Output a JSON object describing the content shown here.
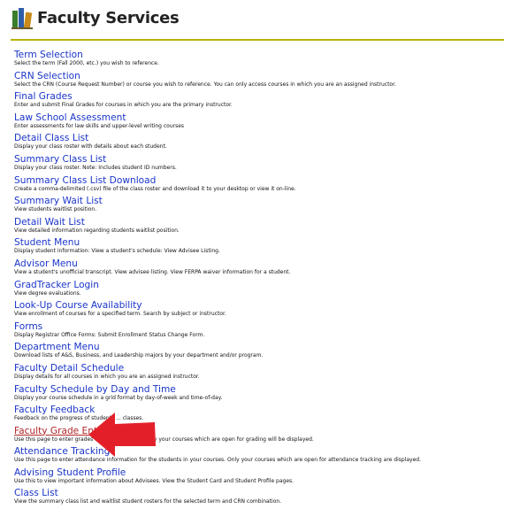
{
  "header": {
    "title": "Faculty Services",
    "accent_color": "#b9b400",
    "logo_icon": "books-icon"
  },
  "menu": [
    {
      "label": "Term Selection",
      "desc": "Select the term (Fall 2000, etc.) you wish to reference."
    },
    {
      "label": "CRN Selection",
      "desc": "Select the CRN (Course Request Number) or course you wish to reference. You can only access courses in which you are an assigned instructor."
    },
    {
      "label": "Final Grades",
      "desc": "Enter and submit Final Grades for courses in which you are the primary instructor."
    },
    {
      "label": "Law School Assessment",
      "desc": "Enter assessments for law skills and upper-level writing courses"
    },
    {
      "label": "Detail Class List",
      "desc": "Display your class roster with details about each student."
    },
    {
      "label": "Summary Class List",
      "desc": "Display your class roster. Note: Includes student ID numbers."
    },
    {
      "label": "Summary Class List Download",
      "desc": "Create a comma-delimited (.csv) file of the class roster and download it to your desktop or view it on-line."
    },
    {
      "label": "Summary Wait List",
      "desc": "View students waitlist position."
    },
    {
      "label": "Detail Wait List",
      "desc": "View detailed information regarding students waitlist position."
    },
    {
      "label": "Student Menu",
      "desc": "Display student information: View a student's schedule: View Advisee Listing."
    },
    {
      "label": "Advisor Menu",
      "desc": "View a student's unofficial transcript. View advisee listing. View FERPA waiver information for a student."
    },
    {
      "label": "GradTracker Login",
      "desc": "View degree evaluations."
    },
    {
      "label": "Look-Up Course Availability",
      "desc": "View enrollment of courses for a specified term. Search by subject or instructor."
    },
    {
      "label": "Forms",
      "desc": "Display Registrar Office Forms: Submit Enrollment Status Change Form."
    },
    {
      "label": "Department Menu",
      "desc": "Download lists of A&S, Business, and Leadership majors by your department and/or program."
    },
    {
      "label": "Faculty Detail Schedule",
      "desc": "Display details for all courses in which you are an assigned instructor."
    },
    {
      "label": "Faculty Schedule by Day and Time",
      "desc": "Display your course schedule in a grid format by day-of-week and time-of-day."
    },
    {
      "label": "Faculty Feedback",
      "desc": "Feedback on the progress of students ... classes."
    },
    {
      "label": "Faculty Grade Entry",
      "desc": "Use this page to enter grades for the ... courses. Only your courses which are open for grading will be displayed."
    },
    {
      "label": "Attendance Tracking",
      "desc": "Use this page to enter attendance information for the students in your courses. Only your courses which are open for attendance tracking are displayed."
    },
    {
      "label": "Advising Student Profile",
      "desc": "Use this to view important information about Advisees. View the Student Card and Student Profile pages."
    },
    {
      "label": "Class List",
      "desc": "View the summary class list and waitlist student rosters for the selected term and CRN combination."
    }
  ],
  "highlight": {
    "item_label": "Faculty Grade Entry",
    "arrow_color": "#e3202a",
    "icon": "red-arrow-icon"
  }
}
